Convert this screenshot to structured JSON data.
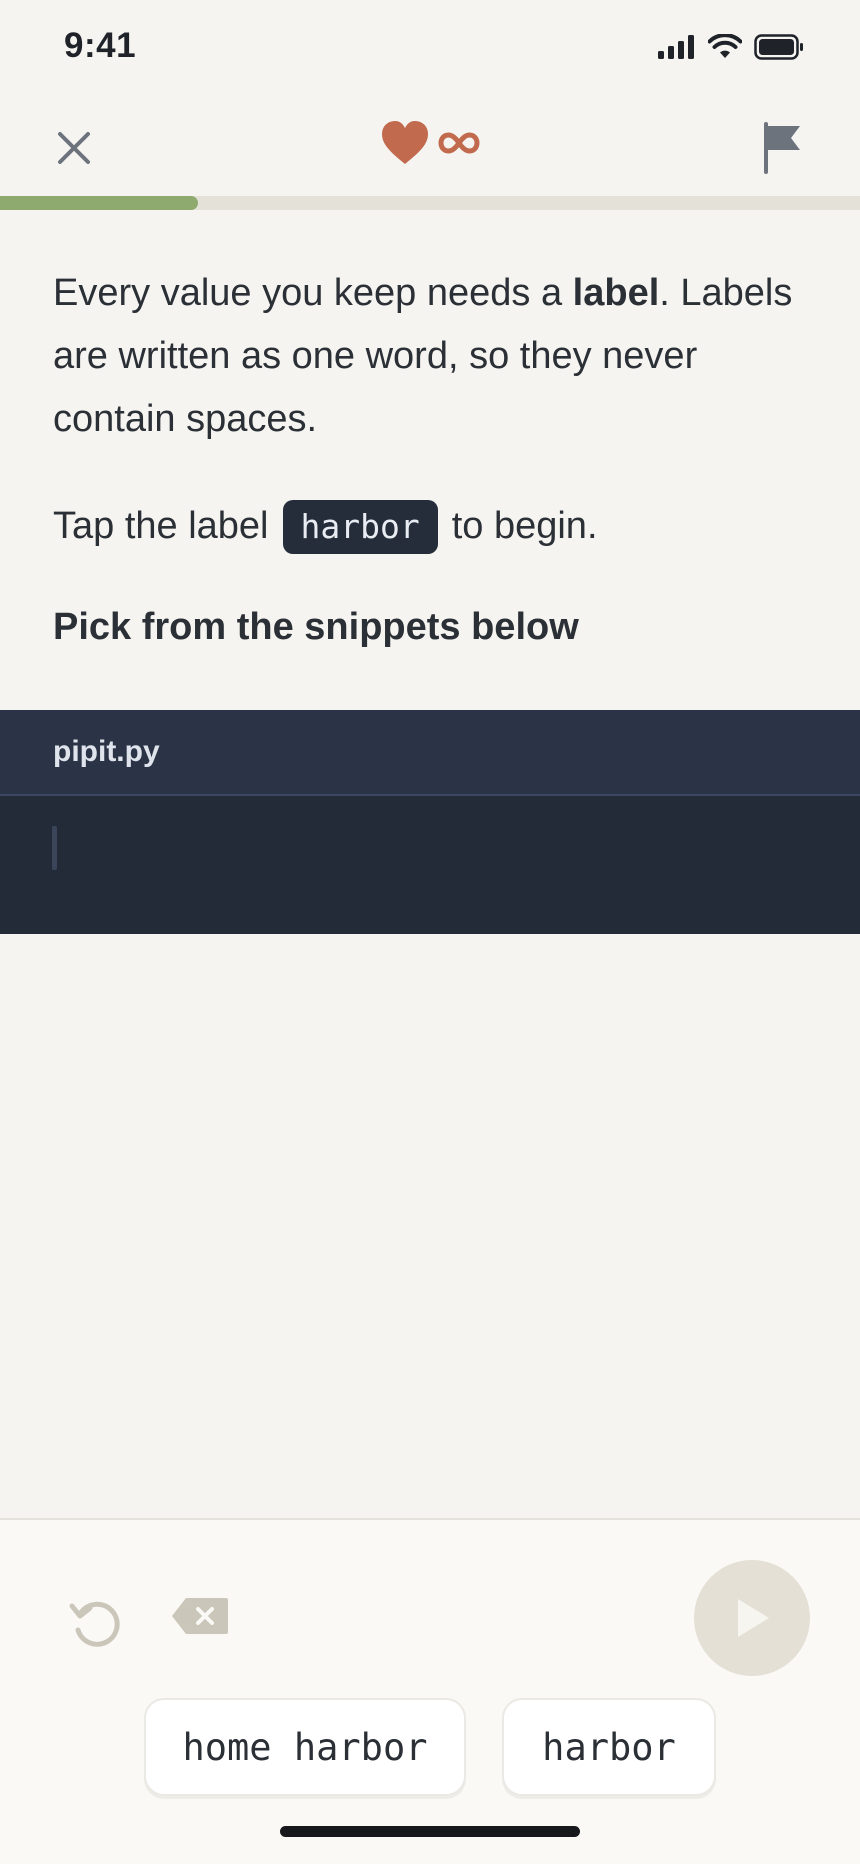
{
  "status_bar": {
    "time": "9:41"
  },
  "header": {
    "lives_icon": "heart-icon",
    "lives_value": "∞",
    "accent": "#c26a4e"
  },
  "progress": {
    "fraction": 0.23,
    "fill_color": "#8eaa6e"
  },
  "lesson": {
    "intro_before": "Every value you keep needs a ",
    "intro_bold": "label",
    "intro_after": ". Labels are written as one word, so they never contain spaces.",
    "tap_before": "Tap the label",
    "tap_chip": "harbor",
    "tap_after": "to begin.",
    "pick_heading": "Pick from the snippets below"
  },
  "editor": {
    "filename": "pipit.py"
  },
  "snippets": [
    "home harbor",
    "harbor"
  ]
}
